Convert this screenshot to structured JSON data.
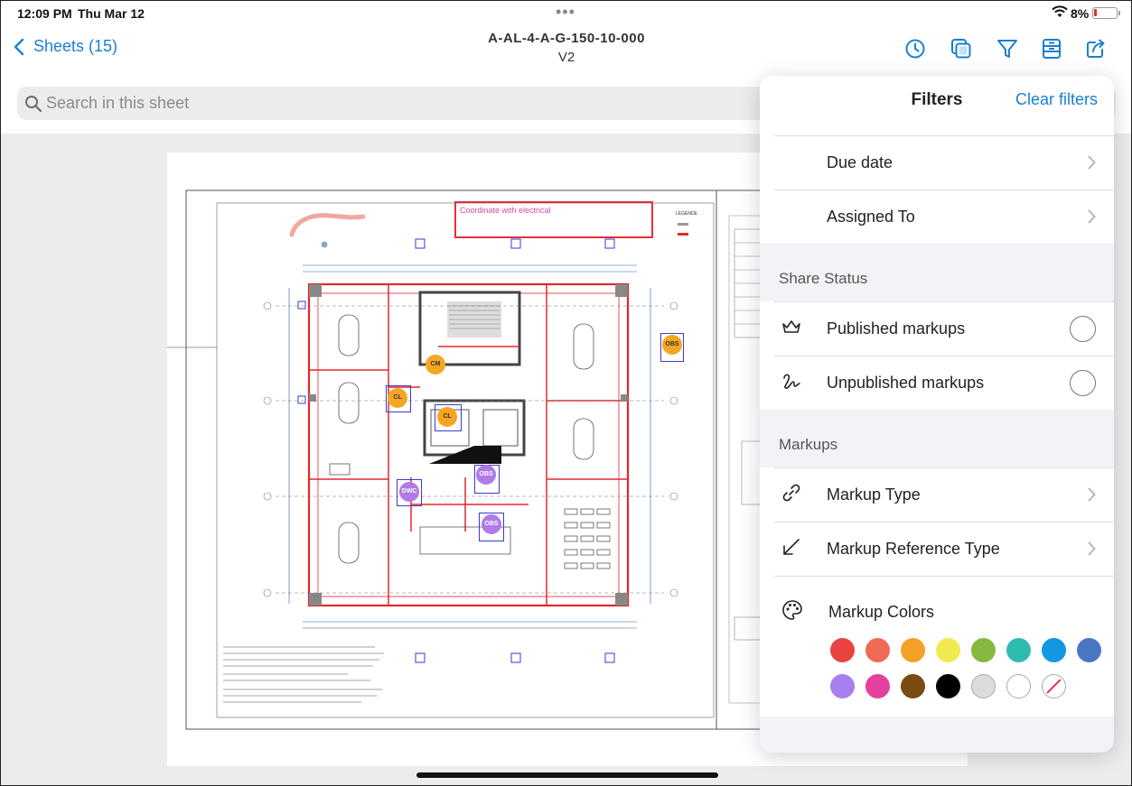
{
  "status_bar": {
    "time": "12:09 PM",
    "date": "Thu Mar 12",
    "battery": "8%"
  },
  "nav": {
    "back_label": "Sheets (15)",
    "sheet_title": "A-AL-4-A-G-150-10-000",
    "sheet_version": "V2"
  },
  "toolbar_icons": [
    "clock-icon",
    "layers-icon",
    "filter-icon",
    "sheet-info-icon",
    "share-icon"
  ],
  "search": {
    "placeholder": "Search in this sheet",
    "value": ""
  },
  "drawing": {
    "markup_note": "Coordinate with electrical",
    "badges": [
      "CM",
      "CL",
      "CL",
      "OBS",
      "DWC",
      "OBS",
      "OBS"
    ]
  },
  "filters": {
    "title": "Filters",
    "clear_label": "Clear filters",
    "rows_top": [
      {
        "label": "Due date"
      },
      {
        "label": "Assigned To"
      }
    ],
    "share_status": {
      "heading": "Share Status",
      "items": [
        {
          "label": "Published markups",
          "icon": "crown-icon",
          "selected": false
        },
        {
          "label": "Unpublished markups",
          "icon": "squiggle-icon",
          "selected": false
        }
      ]
    },
    "markups": {
      "heading": "Markups",
      "items": [
        {
          "label": "Markup Type",
          "icon": "link-icon"
        },
        {
          "label": "Markup Reference Type",
          "icon": "arrow-diagonal-icon"
        }
      ],
      "colors_label": "Markup Colors",
      "colors": [
        "#e8433e",
        "#ef6a55",
        "#f5a026",
        "#f0ea50",
        "#86b93f",
        "#2ebcb0",
        "#1297e0",
        "#4a77c3",
        "#a97ef0",
        "#e4409d",
        "#7a4c12",
        "#000000",
        "#dcdcdc",
        "#ffffff",
        "none"
      ]
    }
  }
}
